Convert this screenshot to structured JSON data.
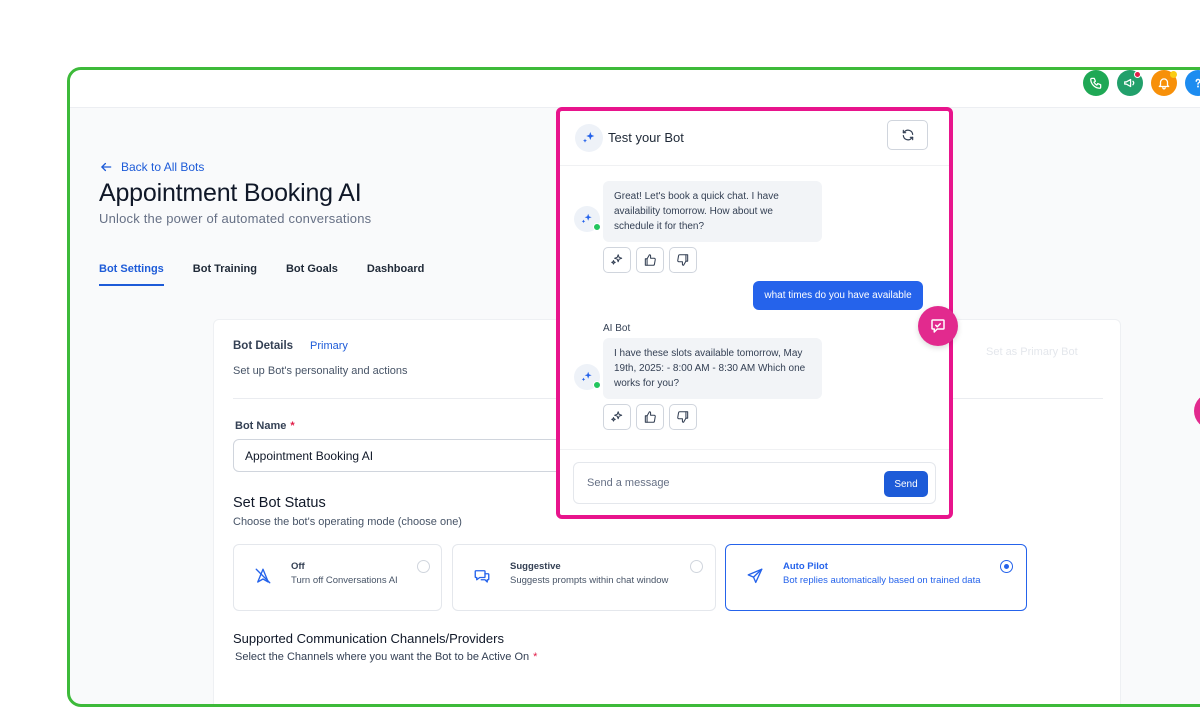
{
  "header": {
    "icons": [
      "phone-icon",
      "megaphone-icon",
      "bell-icon",
      "help-icon"
    ]
  },
  "page": {
    "back_label": "Back to All Bots",
    "title": "Appointment Booking AI",
    "subtitle": "Unlock the power of automated conversations"
  },
  "tabs": [
    {
      "label": "Bot Settings",
      "active": true
    },
    {
      "label": "Bot Training",
      "active": false
    },
    {
      "label": "Bot Goals",
      "active": false
    },
    {
      "label": "Dashboard",
      "active": false
    }
  ],
  "bot_details": {
    "title": "Bot Details",
    "badge": "Primary",
    "description": "Set up Bot's personality and actions",
    "primary_button": "Set as Primary Bot",
    "bot_name_label": "Bot Name",
    "required_mark": "*",
    "bot_name_value": "Appointment Booking AI"
  },
  "status": {
    "title": "Set Bot Status",
    "description": "Choose the bot's operating mode (choose one)",
    "modes": [
      {
        "title": "Off",
        "description": "Turn off Conversations AI",
        "selected": false
      },
      {
        "title": "Suggestive",
        "description": "Suggests prompts within chat window",
        "selected": false
      },
      {
        "title": "Auto Pilot",
        "description": "Bot replies automatically based on trained data",
        "selected": true
      }
    ]
  },
  "channels": {
    "title": "Supported Communication Channels/Providers",
    "description": "Select the Channels where you want the Bot to be Active On",
    "required_mark": "*"
  },
  "chat": {
    "title": "Test your Bot",
    "messages": [
      {
        "from": "bot",
        "text": "Great! Let's book a quick chat. I have availability tomorrow. How about we schedule it for then?"
      },
      {
        "from": "user",
        "text": "what times do you have available"
      },
      {
        "from": "bot",
        "sender": "AI Bot",
        "text": "I have these slots available tomorrow, May 19th, 2025: - 8:00 AM - 8:30 AM Which one works for you?"
      }
    ],
    "input_placeholder": "Send a message",
    "send_label": "Send"
  },
  "colors": {
    "accent": "#1d5bd8",
    "frame_border": "#3dba3a",
    "highlight": "#e8148c",
    "online": "#22c55e"
  }
}
